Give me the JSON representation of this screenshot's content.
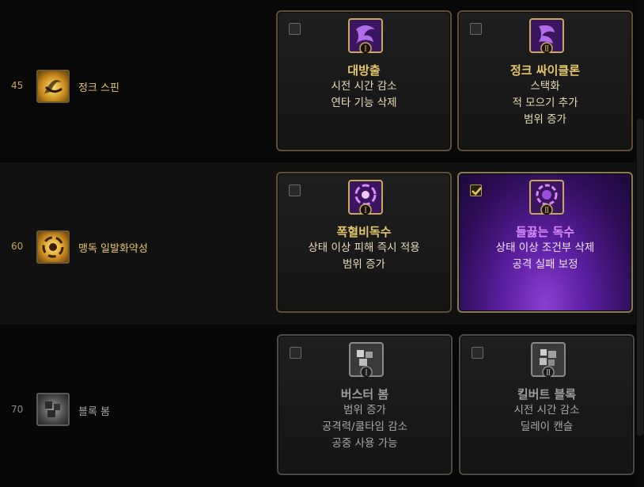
{
  "colors": {
    "level_gold": "#c8a554",
    "level_grey": "#8a8a8a",
    "name_gold": "#e6c66a",
    "name_grey": "#a0a0a0"
  },
  "rows": [
    {
      "level": "45",
      "skill_name": "정크 스핀",
      "skill_icon": "junk-spin-icon",
      "options": [
        {
          "roman": "Ⅰ",
          "checked": false,
          "title": "대방출",
          "lines": [
            "시전 시간 감소",
            "연타 기능 삭제"
          ]
        },
        {
          "roman": "Ⅱ",
          "checked": false,
          "title": "정크 싸이클론",
          "lines": [
            "스택화",
            "적 모으기 추가",
            "범위 증가"
          ]
        }
      ]
    },
    {
      "level": "60",
      "skill_name": "맹독 일발화약성",
      "skill_icon": "venom-burst-icon",
      "options": [
        {
          "roman": "Ⅰ",
          "checked": false,
          "title": "폭혈비독수",
          "lines": [
            "상태 이상 피해 즉시 적용",
            "범위 증가"
          ]
        },
        {
          "roman": "Ⅱ",
          "checked": true,
          "title": "들끓는 독수",
          "lines": [
            "상태 이상 조건부 삭제",
            "공격 실패 보정"
          ]
        }
      ]
    },
    {
      "level": "70",
      "skill_name": "블록 봄",
      "skill_icon": "block-bomb-icon",
      "options": [
        {
          "roman": "Ⅰ",
          "checked": false,
          "title": "버스터 봄",
          "lines": [
            "범위 증가",
            "공격력/쿨타임 감소",
            "공중 사용 가능"
          ]
        },
        {
          "roman": "Ⅱ",
          "checked": false,
          "title": "킬버트 블록",
          "lines": [
            "시전 시간 감소",
            "딜레이 캔슬"
          ]
        }
      ]
    }
  ]
}
